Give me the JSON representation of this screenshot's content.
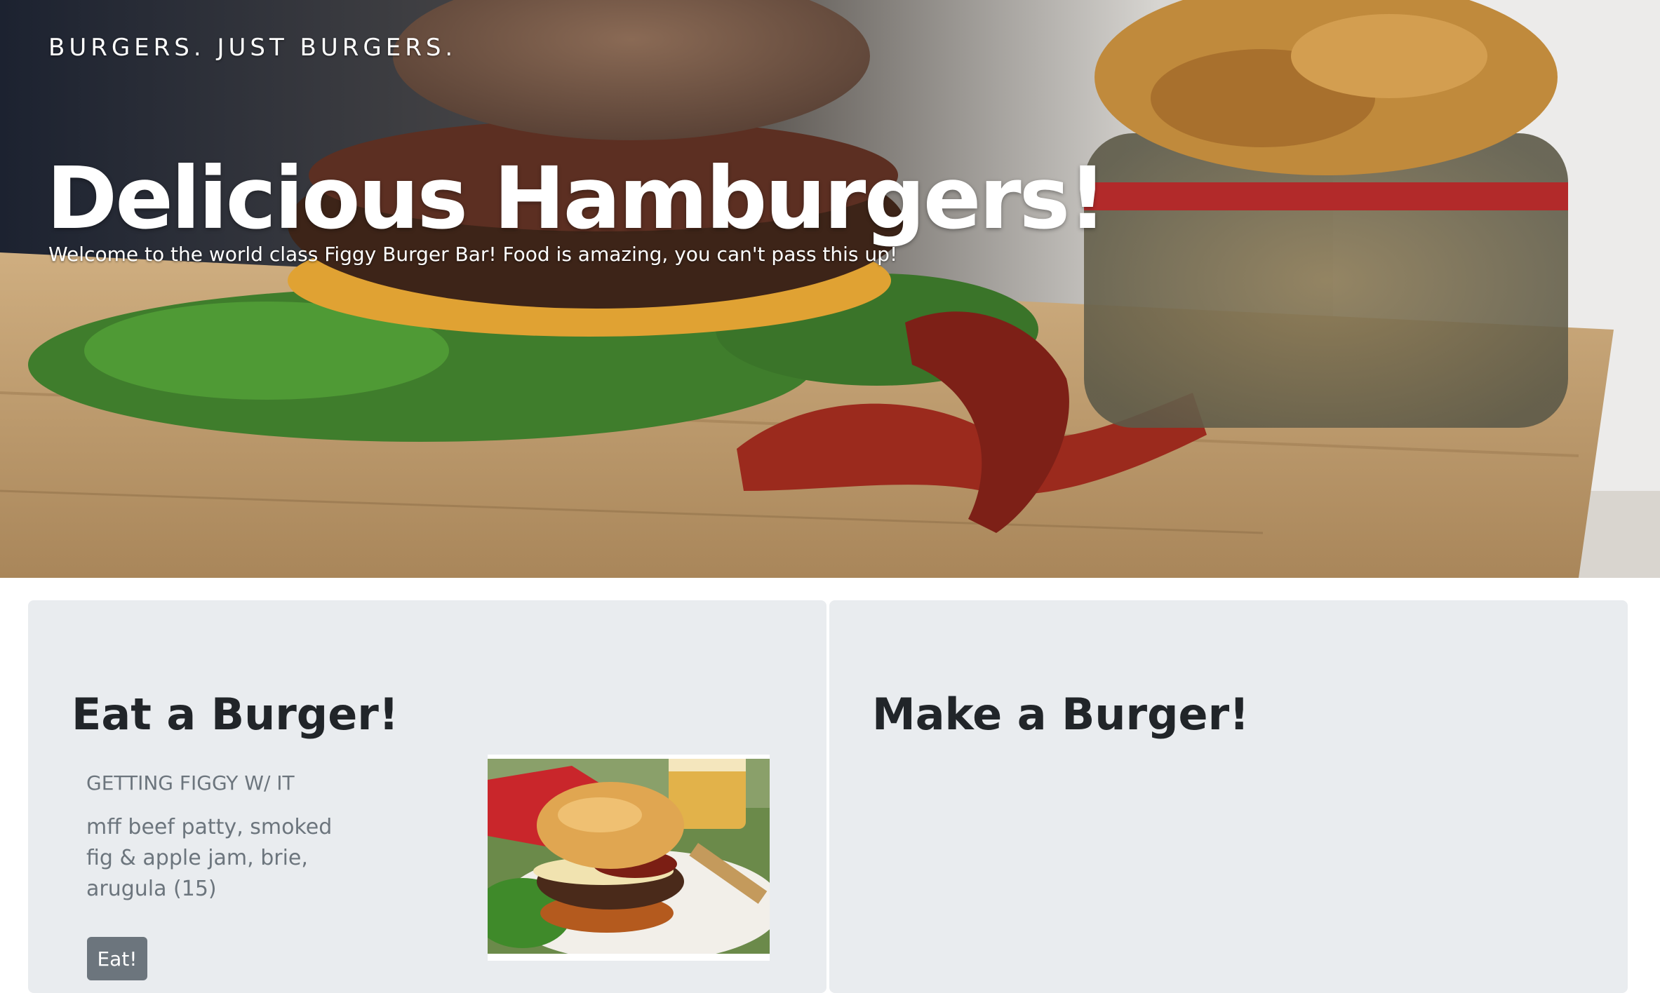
{
  "hero": {
    "tagline": "BURGERS. JUST BURGERS.",
    "title": "Delicious Hamburgers!",
    "welcome": "Welcome to the world class Figgy Burger Bar! Food is amazing, you can't pass this up!"
  },
  "eat_panel": {
    "heading": "Eat a Burger!",
    "burger": {
      "name": "GETTING FIGGY W/ IT",
      "description": "mff beef patty, smoked fig & apple jam, brie, arugula (15)",
      "button_label": "Eat!"
    }
  },
  "make_panel": {
    "heading": "Make a Burger!"
  },
  "colors": {
    "panel_background": "#e9ecef",
    "heading_text": "#212529",
    "muted_text": "#6c757d",
    "button_background": "#6c757d"
  }
}
